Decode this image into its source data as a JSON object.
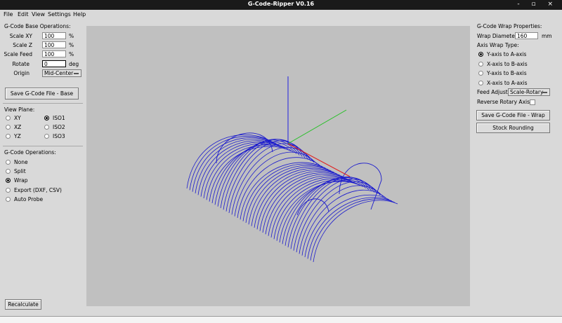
{
  "window": {
    "title": "G-Code-Ripper V0.16",
    "controls": "- ▫ ×"
  },
  "menu": {
    "file": "File",
    "edit": "Edit",
    "view": "View",
    "settings": "Settings",
    "help": "Help"
  },
  "base_ops": {
    "heading": "G-Code Base Operations:",
    "scale_xy_label": "Scale XY",
    "scale_xy_value": "100",
    "scale_xy_unit": "%",
    "scale_z_label": "Scale Z",
    "scale_z_value": "100",
    "scale_z_unit": "%",
    "scale_feed_label": "Scale Feed",
    "scale_feed_value": "100",
    "scale_feed_unit": "%",
    "rotate_label": "Rotate",
    "rotate_value": "0",
    "rotate_unit": "deg",
    "origin_label": "Origin",
    "origin_value": "Mid-Center",
    "save_button": "Save G-Code File - Base"
  },
  "view_plane": {
    "heading": "View Plane:",
    "xy": "XY",
    "xz": "XZ",
    "yz": "YZ",
    "iso1": "ISO1",
    "iso2": "ISO2",
    "iso3": "ISO3",
    "selected": "ISO1"
  },
  "operations": {
    "heading": "G-Code Operations:",
    "none": "None",
    "split": "Split",
    "wrap": "Wrap",
    "export": "Export (DXF, CSV)",
    "auto_probe": "Auto Probe",
    "selected": "Wrap"
  },
  "recalculate_button": "Recalculate",
  "wrap_props": {
    "heading": "G-Code Wrap Properties:",
    "diameter_label": "Wrap Diameter",
    "diameter_value": "160",
    "diameter_unit": "mm",
    "axis_type_label": "Axis Wrap Type:",
    "y_to_a": "Y-axis to A-axis",
    "x_to_b": "X-axis to B-axis",
    "y_to_b": "Y-axis to B-axis",
    "x_to_a": "X-axis to A-axis",
    "selected": "Y-axis to A-axis",
    "feed_adjust_label": "Feed Adjust:",
    "feed_adjust_value": "Scale-Rotary",
    "reverse_label": "Reverse Rotary Axis",
    "save_button": "Save G-Code File - Wrap",
    "stock_button": "Stock Rounding"
  },
  "colors": {
    "toolpath": "#1a1acd",
    "axis_x": "#e02020",
    "axis_y": "#20c020",
    "axis_z": "#2020e0",
    "canvas": "#c0c0c0"
  }
}
